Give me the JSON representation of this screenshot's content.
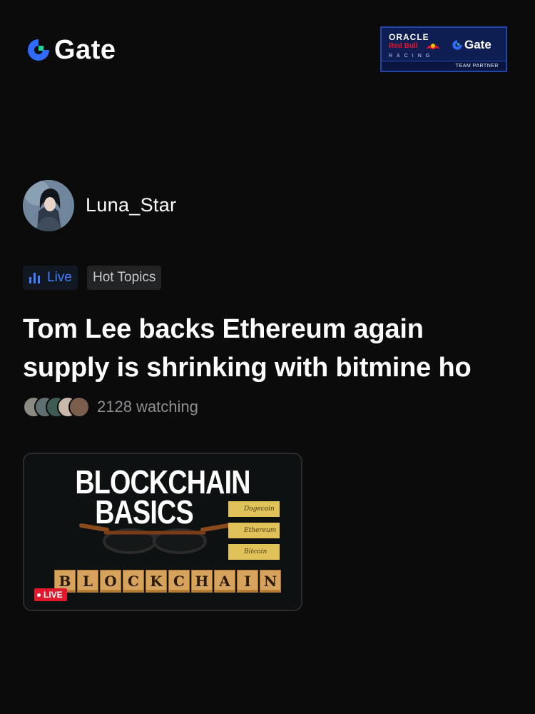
{
  "header": {
    "logo_text": "Gate",
    "partner": {
      "oracle": "ORACLE",
      "redbull": "Red Bull",
      "racing": "RACING",
      "gate": "Gate",
      "team": "TEAM PARTNER"
    }
  },
  "profile": {
    "username": "Luna_Star"
  },
  "tags": {
    "live": "Live",
    "hot": "Hot Topics"
  },
  "post": {
    "title": "Tom Lee backs Ethereum again\nsupply is shrinking with bitmine ho",
    "watching": "2128 watching"
  },
  "thumbnail": {
    "line1": "BLOCKCHAIN",
    "line2": "BASICS",
    "notes": [
      "Dogecoin",
      "Ethereum",
      "Bitcoin"
    ],
    "tiles": [
      "B",
      "L",
      "O",
      "C",
      "K",
      "C",
      "H",
      "A",
      "I",
      "N"
    ],
    "badge": "LIVE"
  },
  "colors": {
    "accent": "#3f7fff",
    "live_red": "#e2192c",
    "background": "#0b0b0c"
  }
}
